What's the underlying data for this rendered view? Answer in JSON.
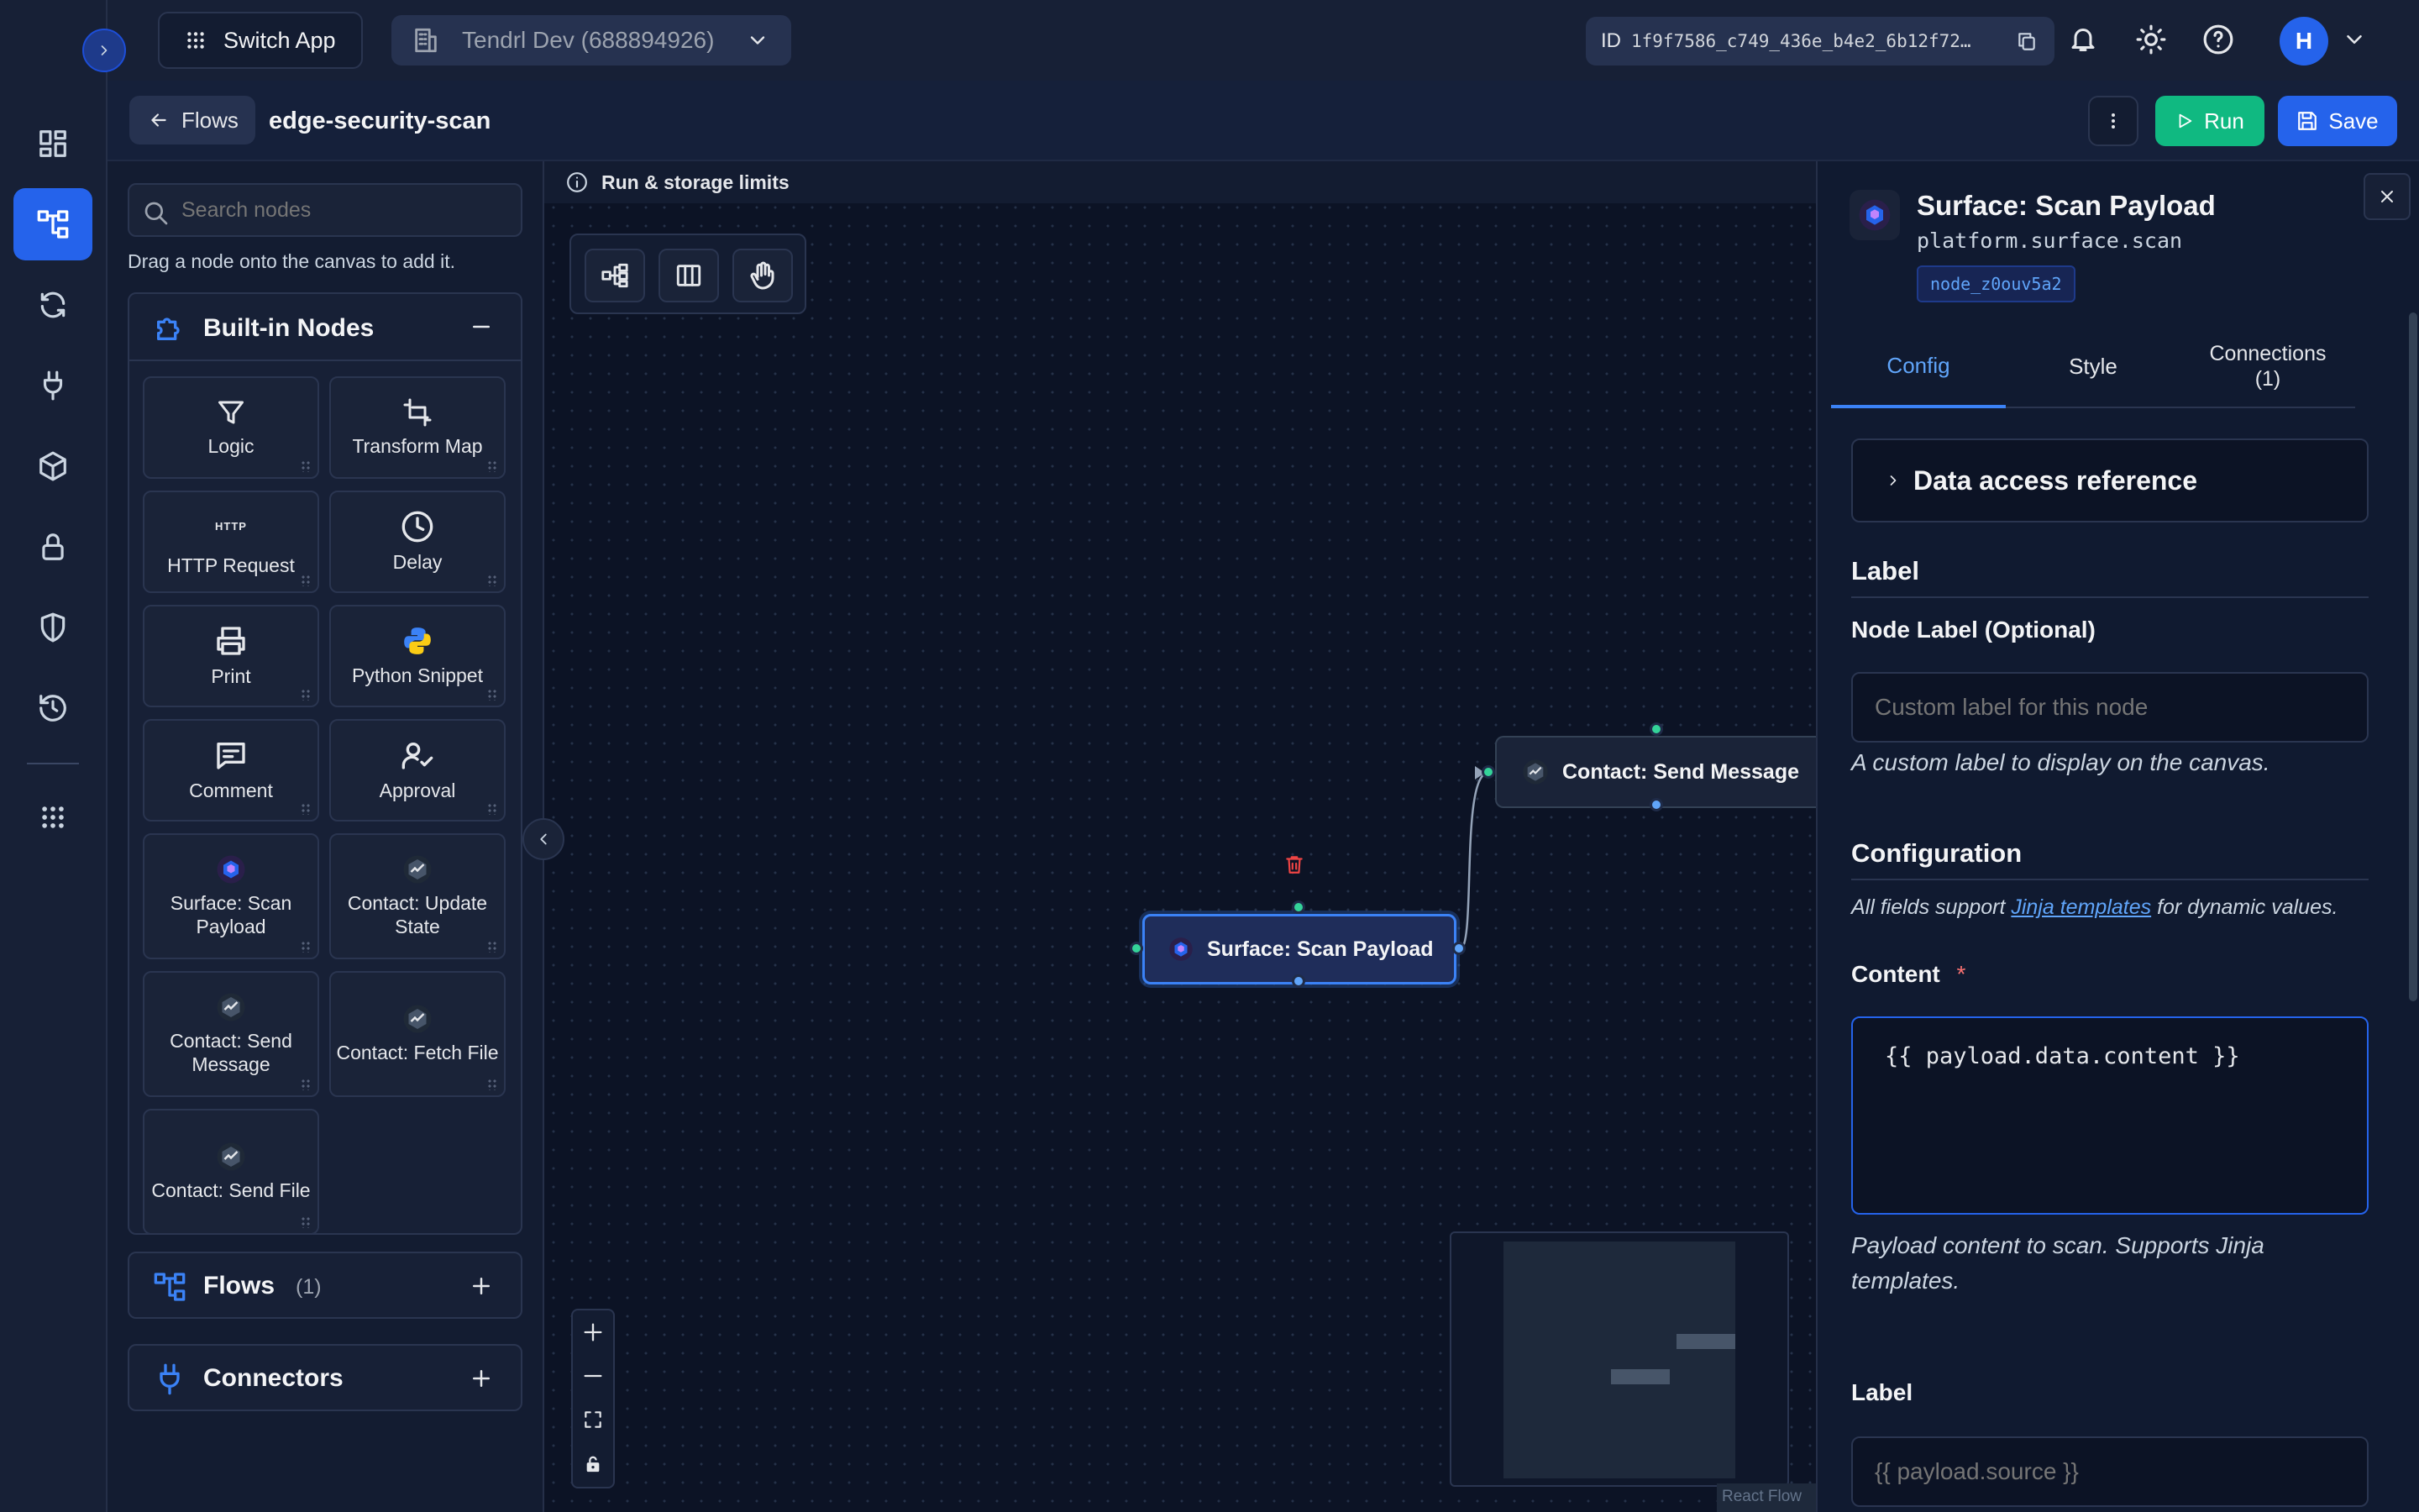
{
  "topbar": {
    "switch_app_label": "Switch App",
    "workspace_label": "Tendrl Dev (688894926)",
    "id_prefix": "ID",
    "id_value": "1f9f7586_c749_436e_b4e2_6b12f72…",
    "avatar_initial": "H"
  },
  "subbar": {
    "back_label": "Flows",
    "flow_name": "edge-security-scan",
    "run_label": "Run",
    "save_label": "Save"
  },
  "sidebar": {
    "search_placeholder": "Search nodes",
    "hint": "Drag a node onto the canvas to add it.",
    "builtin_title": "Built-in Nodes",
    "nodes": [
      {
        "label": "Logic",
        "icon": "filter-icon"
      },
      {
        "label": "Transform Map",
        "icon": "transform-icon"
      },
      {
        "label": "HTTP Request",
        "icon": "http-icon",
        "badge": "HTTP"
      },
      {
        "label": "Delay",
        "icon": "clock-icon"
      },
      {
        "label": "Print",
        "icon": "printer-icon"
      },
      {
        "label": "Python Snippet",
        "icon": "python-icon"
      },
      {
        "label": "Comment",
        "icon": "comment-icon"
      },
      {
        "label": "Approval",
        "icon": "approval-icon"
      },
      {
        "label": "Surface: Scan Payload",
        "icon": "surface-icon"
      },
      {
        "label": "Contact: Update State",
        "icon": "contact-icon"
      },
      {
        "label": "Contact: Send Message",
        "icon": "contact-icon"
      },
      {
        "label": "Contact: Fetch File",
        "icon": "contact-icon"
      },
      {
        "label": "Contact: Send File",
        "icon": "contact-icon"
      }
    ],
    "flows_title": "Flows",
    "flows_count": "(1)",
    "connectors_title": "Connectors"
  },
  "canvas": {
    "limits_label": "Run & storage limits",
    "node_selected": "Surface: Scan Payload",
    "node_target": "Contact: Send Message",
    "watermark": "React Flow"
  },
  "panel": {
    "title": "Surface: Scan Payload",
    "subtitle": "platform.surface.scan",
    "node_id": "node_z0ouv5a2",
    "tabs": [
      "Config",
      "Style",
      "Connections\n(1)"
    ],
    "active_tab": "Config",
    "data_access_label": "Data access reference",
    "label_section": "Label",
    "node_label_title": "Node Label (Optional)",
    "node_label_placeholder": "Custom label for this node",
    "node_label_help": "A custom label to display on the canvas.",
    "config_section": "Configuration",
    "config_help_pre": "All fields support ",
    "config_help_link": "Jinja templates",
    "config_help_post": " for dynamic values.",
    "content_label": "Content",
    "content_required": "*",
    "content_value": "{{ payload.data.content }}",
    "content_help": "Payload content to scan. Supports Jinja templates.",
    "label2_title": "Label",
    "label2_placeholder": "{{ payload.source }}"
  },
  "colors": {
    "accent": "#2563eb",
    "run_green": "#10b981",
    "handle_green": "#34d399",
    "handle_blue": "#60a5fa",
    "link": "#60a5fa",
    "required": "#f87171"
  }
}
